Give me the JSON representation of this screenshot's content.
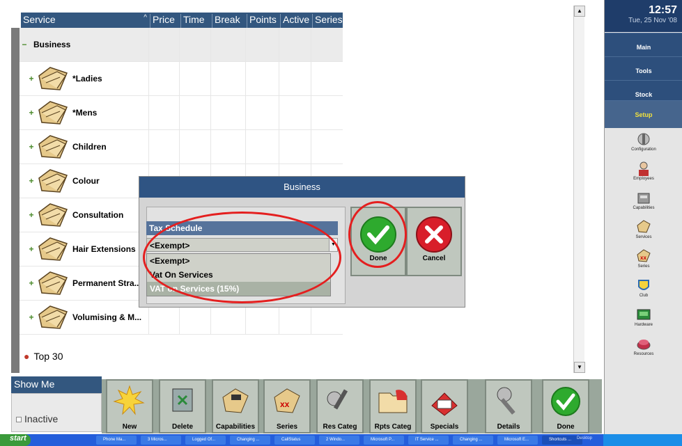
{
  "grid": {
    "columns": [
      "Service",
      "Price",
      "Time",
      "Break",
      "Points",
      "Active",
      "Series"
    ],
    "rows": [
      {
        "label": "Business",
        "expander": "−",
        "group": true
      },
      {
        "label": "*Ladies",
        "expander": "+"
      },
      {
        "label": "*Mens",
        "expander": "+"
      },
      {
        "label": "Children",
        "expander": "+"
      },
      {
        "label": "Colour",
        "expander": "+"
      },
      {
        "label": "Consultation",
        "expander": "+"
      },
      {
        "label": "Hair Extensions",
        "expander": "+"
      },
      {
        "label": "Permanent Stra...",
        "expander": "+"
      },
      {
        "label": "Volumising & M...",
        "expander": "+"
      }
    ],
    "top30": "Top 30"
  },
  "sidebar": {
    "time": "12:57",
    "date": "Tue, 25 Nov '08",
    "nav": [
      "Main",
      "Tools",
      "Stock",
      "Setup"
    ],
    "items": [
      "Configuration",
      "Employees",
      "Capabilities",
      "Services",
      "Series",
      "Club",
      "Hardware",
      "Resources"
    ]
  },
  "dialog": {
    "title": "Business",
    "tax_label": "Tax Schedule",
    "tax_value": "<Exempt>",
    "options": [
      "<Exempt>",
      "Vat On Services",
      "VAT on Services (15%)"
    ],
    "done": "Done",
    "cancel": "Cancel"
  },
  "bottom": {
    "show_me": "Show Me",
    "inactive": "Inactive",
    "buttons": [
      "New",
      "Delete",
      "Capabilities",
      "Series",
      "Res Categ",
      "Rpts Categ",
      "Specials",
      "Details",
      "Done"
    ]
  },
  "taskbar": {
    "start": "start",
    "tasks": [
      "Phone Ma...",
      "3 Micros...",
      "Logged Of...",
      "Changing ...",
      "CallStatus",
      "2 Windo...",
      "Microsoft P...",
      "IT Service ...",
      "Changing ...",
      "Microsoft E...",
      "Shortcuts ..."
    ],
    "desktop": "Desktop"
  }
}
